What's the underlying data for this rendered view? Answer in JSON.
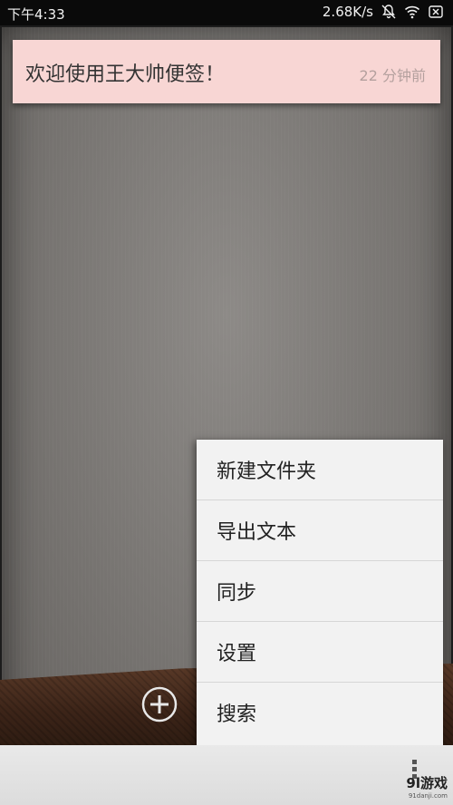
{
  "status_bar": {
    "time": "下午4:33",
    "speed": "2.68K/s",
    "icons": [
      "bell-muted-icon",
      "wifi-icon",
      "sim-off-icon"
    ]
  },
  "note": {
    "title": "欢迎使用王大帅便签！",
    "time": "22 分钟前",
    "background_color": "#f8d6d4"
  },
  "menu": {
    "items": [
      {
        "label": "新建文件夹"
      },
      {
        "label": "导出文本"
      },
      {
        "label": "同步"
      },
      {
        "label": "设置"
      },
      {
        "label": "搜索"
      }
    ]
  },
  "add_button": {
    "icon": "plus-circle-icon"
  },
  "bottom_bar": {
    "overflow_icon": "more-vertical-icon"
  },
  "watermark": {
    "main": "9l游戏",
    "sub": "91danji.com"
  }
}
